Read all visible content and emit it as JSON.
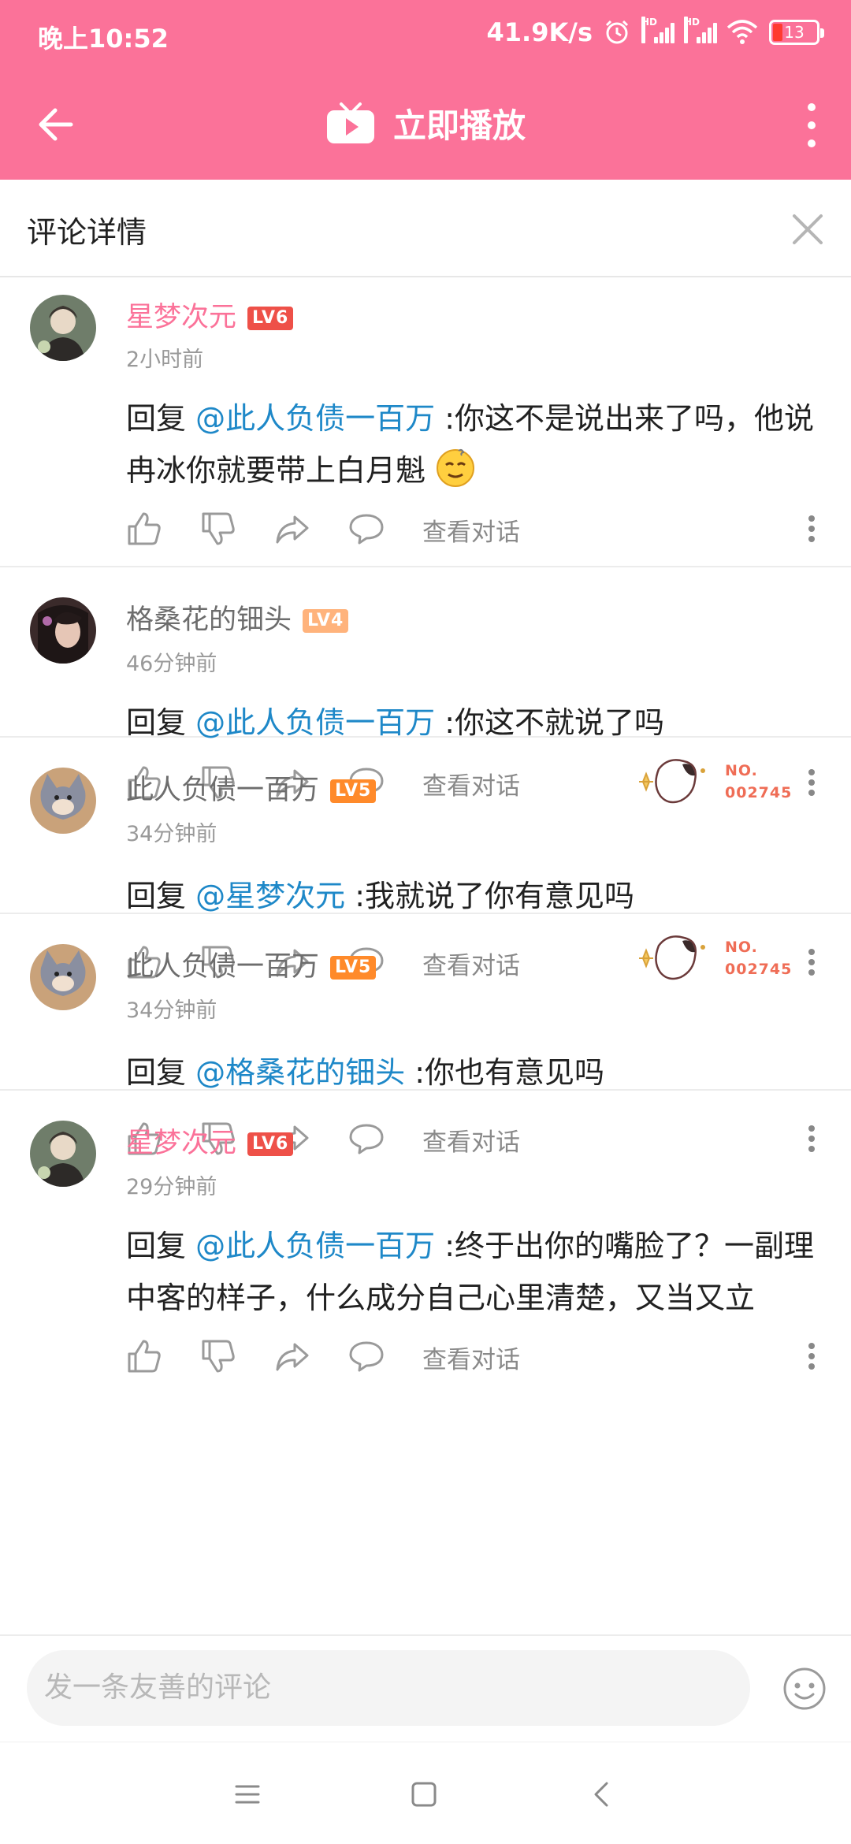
{
  "status": {
    "time": "晚上10:52",
    "speed": "41.9K/s",
    "battery": "13",
    "signal_label": "HD"
  },
  "nav": {
    "title": "立即播放"
  },
  "detail": {
    "title": "评论详情"
  },
  "comments": [
    {
      "name": "星梦次元",
      "level": "LV6",
      "time": "2小时前",
      "reply_prefix": "回复 ",
      "mention": "@此人负债一百万",
      "text": " :你这不是说出来了吗，他说冉冰你就要带上白月魁",
      "view": "查看对话"
    },
    {
      "name": "格桑花的钿头",
      "level": "LV4",
      "time": "46分钟前",
      "reply_prefix": "回复 ",
      "mention": "@此人负债一百万",
      "text": " :你这不就说了吗",
      "view": "查看对话"
    },
    {
      "name": "此人负债一百万",
      "level": "LV5",
      "time": "34分钟前",
      "reply_prefix": "回复 ",
      "mention": "@星梦次元",
      "text": " :我就说了你有意见吗",
      "view": "查看对话",
      "badge_no": "NO.",
      "badge_num": "002745"
    },
    {
      "name": "此人负债一百万",
      "level": "LV5",
      "time": "34分钟前",
      "reply_prefix": "回复 ",
      "mention": "@格桑花的钿头",
      "text": " :你也有意见吗",
      "view": "查看对话",
      "badge_no": "NO.",
      "badge_num": "002745"
    },
    {
      "name": "星梦次元",
      "level": "LV6",
      "time": "29分钟前",
      "reply_prefix": "回复 ",
      "mention": "@此人负债一百万",
      "text": " :终于出你的嘴脸了？一副理中客的样子，什么成分自己心里清楚，又当又立",
      "view": "查看对话"
    }
  ],
  "input": {
    "placeholder": "发一条友善的评论"
  },
  "colors": {
    "brand": "#fb7299",
    "mention": "#1e88c8",
    "lv6": "#ee5048",
    "lv5": "#ff8a2a",
    "lv4": "#ffb37c"
  }
}
